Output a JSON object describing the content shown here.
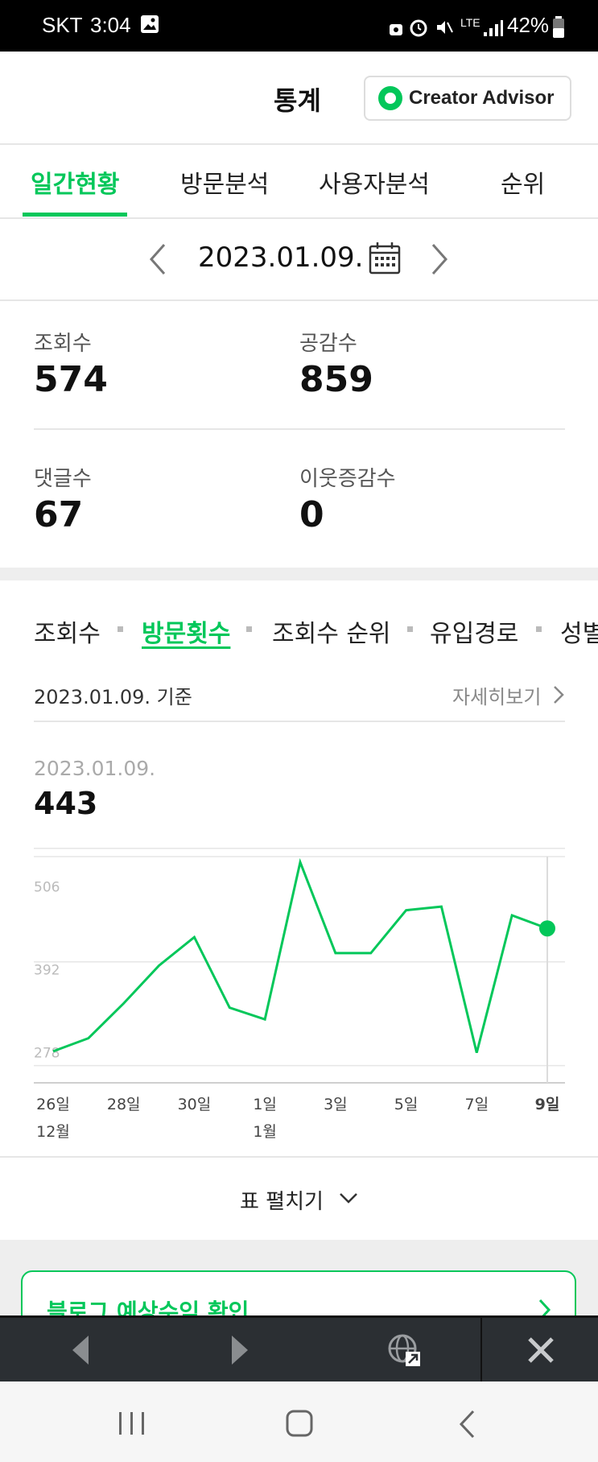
{
  "status_bar": {
    "carrier": "SKT",
    "time": "3:04",
    "network": "LTE",
    "battery": "42%"
  },
  "header": {
    "title": "통계",
    "creator_advisor": "Creator Advisor"
  },
  "tabs": [
    {
      "label": "일간현황",
      "active": true
    },
    {
      "label": "방문분석",
      "active": false
    },
    {
      "label": "사용자분석",
      "active": false
    },
    {
      "label": "순위",
      "active": false
    }
  ],
  "date_nav": {
    "date": "2023.01.09."
  },
  "stats": {
    "views_label": "조회수",
    "views_value": "574",
    "likes_label": "공감수",
    "likes_value": "859",
    "comments_label": "댓글수",
    "comments_value": "67",
    "neighbors_label": "이웃증감수",
    "neighbors_value": "0"
  },
  "sub_tabs": [
    {
      "label": "조회수",
      "active": false
    },
    {
      "label": "방문횟수",
      "active": true
    },
    {
      "label": "조회수 순위",
      "active": false
    },
    {
      "label": "유입경로",
      "active": false
    },
    {
      "label": "성별",
      "active": false
    }
  ],
  "basis": {
    "text": "2023.01.09. 기준",
    "detail_link": "자세히보기"
  },
  "selected": {
    "date": "2023.01.09.",
    "value": "443"
  },
  "chart_data": {
    "type": "line",
    "x": [
      "26일",
      "27일",
      "28일",
      "29일",
      "30일",
      "31일",
      "1일",
      "2일",
      "3일",
      "4일",
      "5일",
      "6일",
      "7일",
      "8일",
      "9일"
    ],
    "x_tick_labels": [
      "26일",
      "28일",
      "30일",
      "1일",
      "3일",
      "5일",
      "7일",
      "9일"
    ],
    "x_month_labels": [
      {
        "at": "26일",
        "label": "12월"
      },
      {
        "at": "1일",
        "label": "1월"
      }
    ],
    "series": [
      {
        "values": [
          280,
          298,
          346,
          398,
          437,
          340,
          324,
          540,
          415,
          415,
          474,
          479,
          278,
          467,
          449
        ]
      }
    ],
    "y_ticks": [
      278,
      392,
      506
    ],
    "ylim": [
      240,
      550
    ],
    "highlight_index": 14,
    "color": "#03c75a"
  },
  "expand": {
    "label": "표 펼치기"
  },
  "revenue_card": {
    "label": "블로그 예상수익 확인"
  },
  "colors": {
    "accent": "#03c75a"
  }
}
